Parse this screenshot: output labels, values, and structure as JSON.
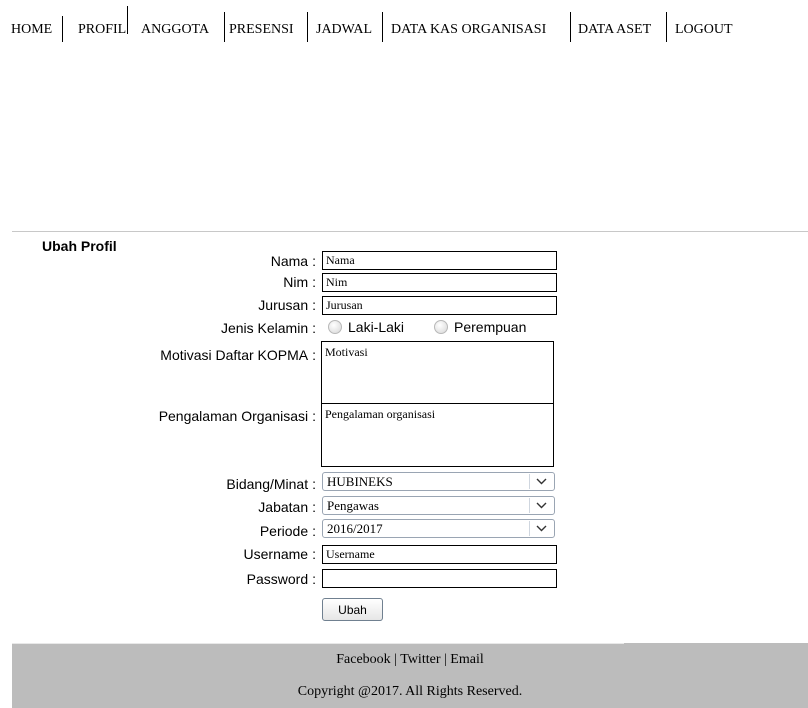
{
  "nav": {
    "items": [
      "HOME",
      "PROFIL",
      "ANGGOTA",
      "PRESENSI",
      "JADWAL",
      "DATA KAS ORGANISASI",
      "DATA ASET",
      "LOGOUT"
    ]
  },
  "form": {
    "title": "Ubah Profil",
    "colon": ":",
    "nama": {
      "label": "Nama",
      "value": "Nama"
    },
    "nim": {
      "label": "Nim",
      "value": "Nim"
    },
    "jurusan": {
      "label": "Jurusan",
      "value": "Jurusan"
    },
    "gender": {
      "label": "Jenis Kelamin",
      "options": [
        "Laki-Laki",
        "Perempuan"
      ]
    },
    "motivasi": {
      "label": "Motivasi Daftar KOPMA",
      "value": "Motivasi"
    },
    "pengalaman": {
      "label": "Pengalaman Organisasi",
      "value": "Pengalaman organisasi"
    },
    "bidang": {
      "label": "Bidang/Minat",
      "value": "HUBINEKS"
    },
    "jabatan": {
      "label": "Jabatan",
      "value": "Pengawas"
    },
    "periode": {
      "label": "Periode",
      "value": "2016/2017"
    },
    "username": {
      "label": "Username",
      "value": "Username"
    },
    "password": {
      "label": "Password",
      "value": ""
    },
    "submit": "Ubah"
  },
  "footer": {
    "facebook": "Facebook",
    "twitter": "Twitter",
    "email": "Email",
    "separator": "|",
    "copyright": "Copyright @2017. All Rights Reserved."
  }
}
